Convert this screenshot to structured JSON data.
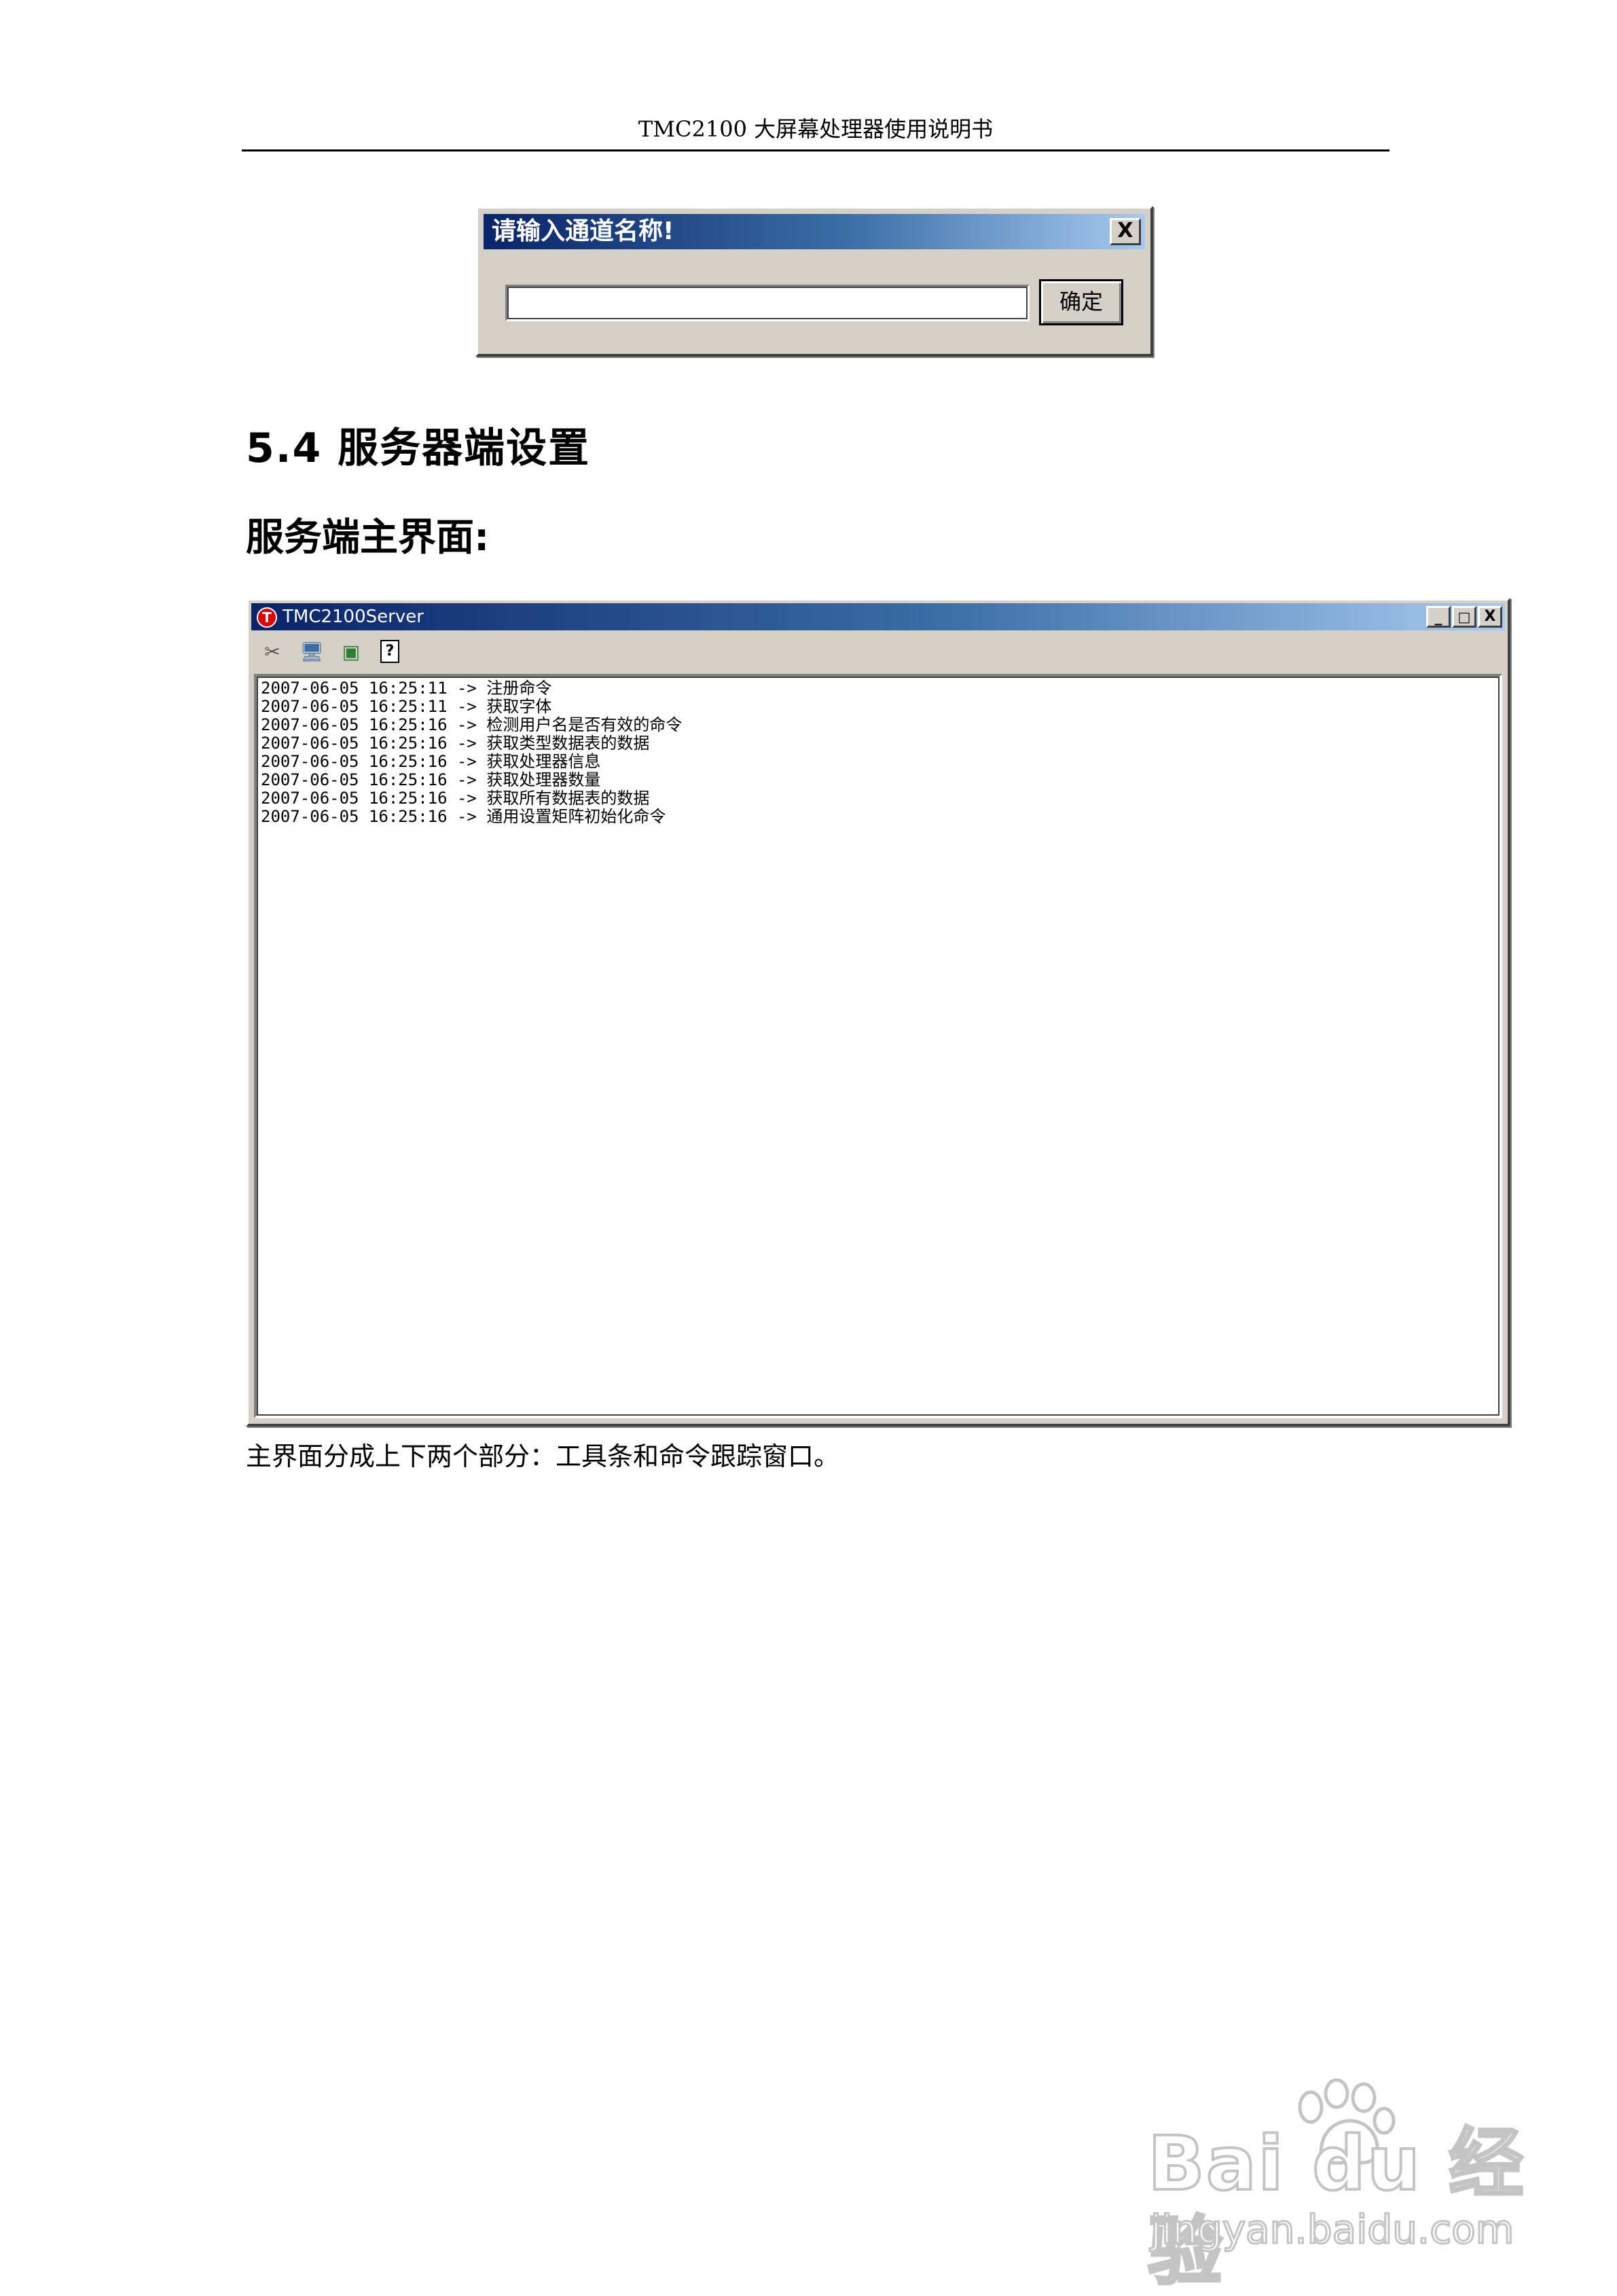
{
  "header": {
    "title": "TMC2100 大屏幕处理器使用说明书"
  },
  "dialog": {
    "title": "请输入通道名称!",
    "close_label": "X",
    "input_value": "",
    "ok_label": "确定"
  },
  "section": {
    "heading": "5.4 服务器端设置",
    "subheading": "服务端主界面:"
  },
  "server_window": {
    "title": "TMC2100Server",
    "icon_letter": "T",
    "controls": {
      "minimize": "_",
      "maximize": "□",
      "close": "X"
    },
    "toolbar": [
      {
        "icon": "tools-icon",
        "glyph": "✂"
      },
      {
        "icon": "network-icon",
        "glyph": "🖥"
      },
      {
        "icon": "image-icon",
        "glyph": "▣"
      },
      {
        "icon": "help-icon",
        "glyph": "?"
      }
    ],
    "log": [
      "2007-06-05 16:25:11 -> 注册命令",
      "2007-06-05 16:25:11 -> 获取字体",
      "2007-06-05 16:25:16 -> 检测用户名是否有效的命令",
      "2007-06-05 16:25:16 -> 获取类型数据表的数据",
      "2007-06-05 16:25:16 -> 获取处理器信息",
      "2007-06-05 16:25:16 -> 获取处理器数量",
      "2007-06-05 16:25:16 -> 获取所有数据表的数据",
      "2007-06-05 16:25:16 -> 通用设置矩阵初始化命令"
    ]
  },
  "caption": "主界面分成上下两个部分：工具条和命令跟踪窗口。",
  "watermark": {
    "brand": "Bai du 经验",
    "url": "jingyan.baidu.com"
  }
}
